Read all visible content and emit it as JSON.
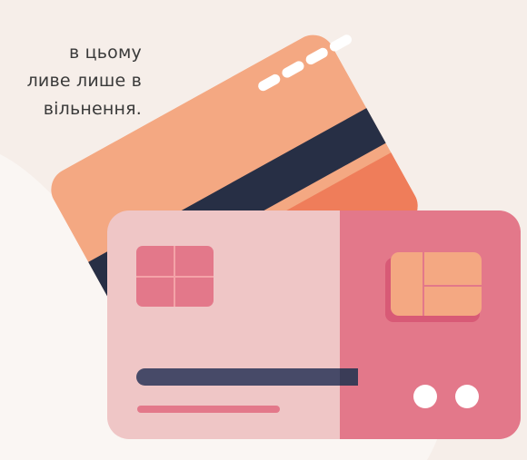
{
  "content": {
    "text_lines": [
      "в цьому",
      "ливе лише в",
      "вільнення."
    ]
  },
  "colors": {
    "background": "#faf6f3",
    "back_card": "#f4a882",
    "back_card_shade": "#ef7d5a",
    "magnetic_stripe": "#272f45",
    "front_card_left": "#efc6c6",
    "front_card_right": "#e3788a",
    "chip_pink": "#e3788a",
    "chip_orange": "#f4a882",
    "bar_dark": "#474a68",
    "bar_pink": "#e3788a",
    "dots": "#ffffff"
  }
}
